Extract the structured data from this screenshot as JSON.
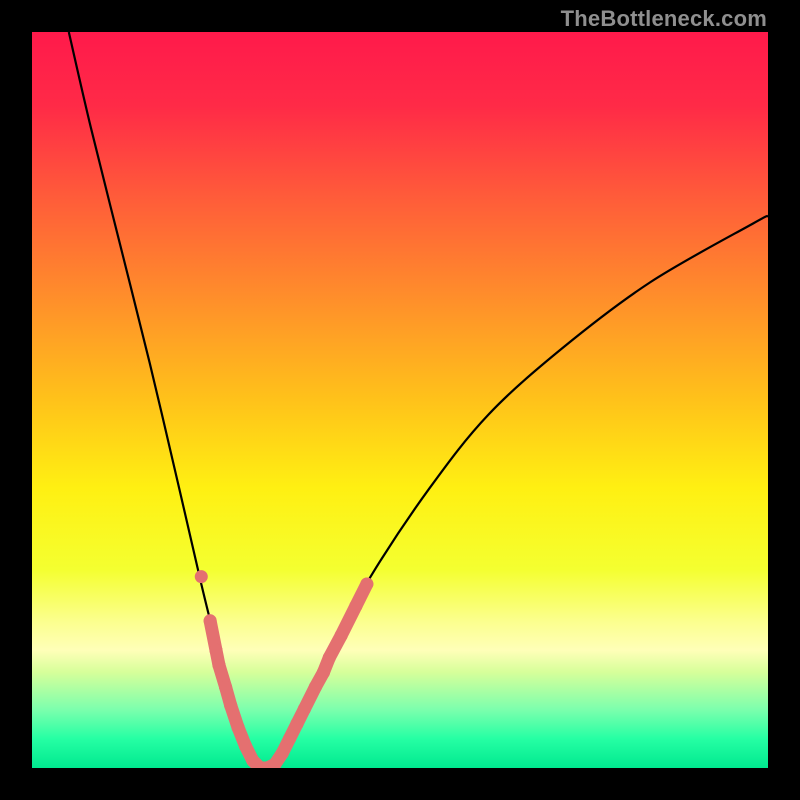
{
  "watermark": "TheBottleneck.com",
  "colors": {
    "frame": "#000000",
    "curve": "#000000",
    "marker": "#e47070",
    "gradient_stops": [
      {
        "pct": 0,
        "color": "#ff1a4b"
      },
      {
        "pct": 10,
        "color": "#ff2a47"
      },
      {
        "pct": 22,
        "color": "#ff5a3a"
      },
      {
        "pct": 35,
        "color": "#ff8a2c"
      },
      {
        "pct": 50,
        "color": "#ffc21a"
      },
      {
        "pct": 62,
        "color": "#fff012"
      },
      {
        "pct": 73,
        "color": "#f4ff30"
      },
      {
        "pct": 80,
        "color": "#fbff8d"
      },
      {
        "pct": 84,
        "color": "#ffffb8"
      },
      {
        "pct": 87,
        "color": "#d6ff9a"
      },
      {
        "pct": 92,
        "color": "#7dffad"
      },
      {
        "pct": 96,
        "color": "#26ffa4"
      },
      {
        "pct": 100,
        "color": "#00e98f"
      }
    ]
  },
  "chart_data": {
    "type": "line",
    "title": "",
    "xlabel": "",
    "ylabel": "",
    "xlim": [
      0,
      100
    ],
    "ylim": [
      0,
      100
    ],
    "annotations": [
      "TheBottleneck.com"
    ],
    "series": [
      {
        "name": "bottleneck-curve",
        "x": [
          5,
          8,
          12,
          16,
          20,
          23,
          25,
          27,
          28,
          29,
          30,
          31,
          32,
          33,
          34,
          36,
          40,
          46,
          54,
          62,
          72,
          84,
          98,
          100
        ],
        "y": [
          100,
          87,
          71,
          55,
          38,
          25,
          17,
          10,
          6,
          3,
          1,
          0,
          0,
          1,
          3,
          7,
          15,
          26,
          38,
          48,
          57,
          66,
          74,
          75
        ]
      }
    ],
    "markers": {
      "name": "highlighted-points",
      "style": "pill-and-dot",
      "color": "#e47070",
      "points": [
        {
          "x": 23.0,
          "y": 26
        },
        {
          "x": 24.2,
          "y": 20
        },
        {
          "x": 25.0,
          "y": 16
        },
        {
          "x": 25.4,
          "y": 14
        },
        {
          "x": 26.3,
          "y": 11
        },
        {
          "x": 27.0,
          "y": 8.5
        },
        {
          "x": 28.0,
          "y": 5.5
        },
        {
          "x": 29.0,
          "y": 3
        },
        {
          "x": 30.0,
          "y": 1
        },
        {
          "x": 31.0,
          "y": 0
        },
        {
          "x": 32.0,
          "y": 0
        },
        {
          "x": 33.0,
          "y": 0.5
        },
        {
          "x": 34.0,
          "y": 2
        },
        {
          "x": 35.0,
          "y": 4
        },
        {
          "x": 36.0,
          "y": 6
        },
        {
          "x": 37.0,
          "y": 8
        },
        {
          "x": 38.5,
          "y": 11
        },
        {
          "x": 39.6,
          "y": 13
        },
        {
          "x": 40.4,
          "y": 15
        },
        {
          "x": 42.0,
          "y": 18
        },
        {
          "x": 44.0,
          "y": 22
        },
        {
          "x": 45.5,
          "y": 25
        }
      ]
    }
  }
}
